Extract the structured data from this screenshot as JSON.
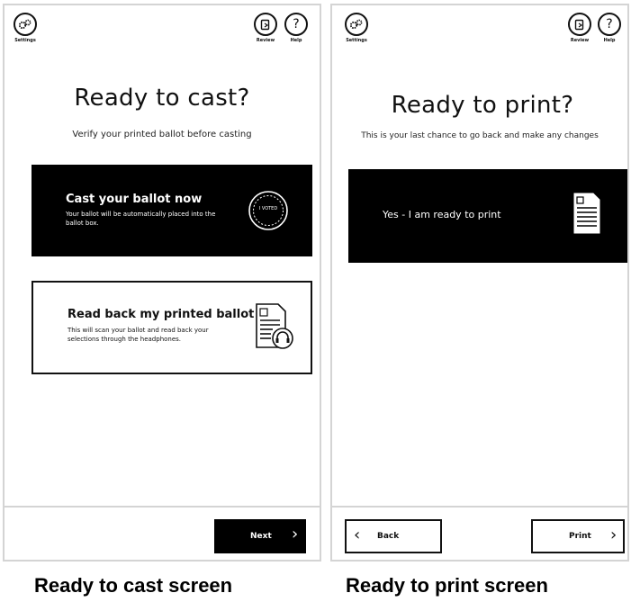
{
  "cast_screen": {
    "settings_label": "Settings",
    "review_label": "Review",
    "help_label": "Help",
    "help_glyph": "?",
    "title": "Ready to cast?",
    "subtitle": "Verify your printed ballot before casting",
    "cast_card": {
      "title": "Cast your ballot now",
      "description": "Your ballot will be automatically placed into the ballot box.",
      "sticker_text": "I VOTED",
      "icon": "i-voted-sticker-icon"
    },
    "readback_card": {
      "title": "Read back my printed ballot",
      "description": "This will scan your ballot and read back your selections through the headphones.",
      "icon": "ballot-headphones-icon"
    },
    "next_label": "Next",
    "next_glyph": "›"
  },
  "print_screen": {
    "settings_label": "Settings",
    "review_label": "Review",
    "help_label": "Help",
    "help_glyph": "?",
    "title": "Ready to print?",
    "subtitle": "This is your last chance to go back and make any changes",
    "print_card": {
      "label": "Yes - I am ready to print",
      "icon": "ballot-document-icon"
    },
    "back_label": "Back",
    "back_glyph": "‹",
    "print_label": "Print",
    "print_glyph": "›"
  },
  "captions": {
    "cast": "Ready to cast screen",
    "print": "Ready to print screen"
  },
  "colors": {
    "card_dark": "#000000",
    "border": "#d4d4d4",
    "text": "#111111"
  }
}
